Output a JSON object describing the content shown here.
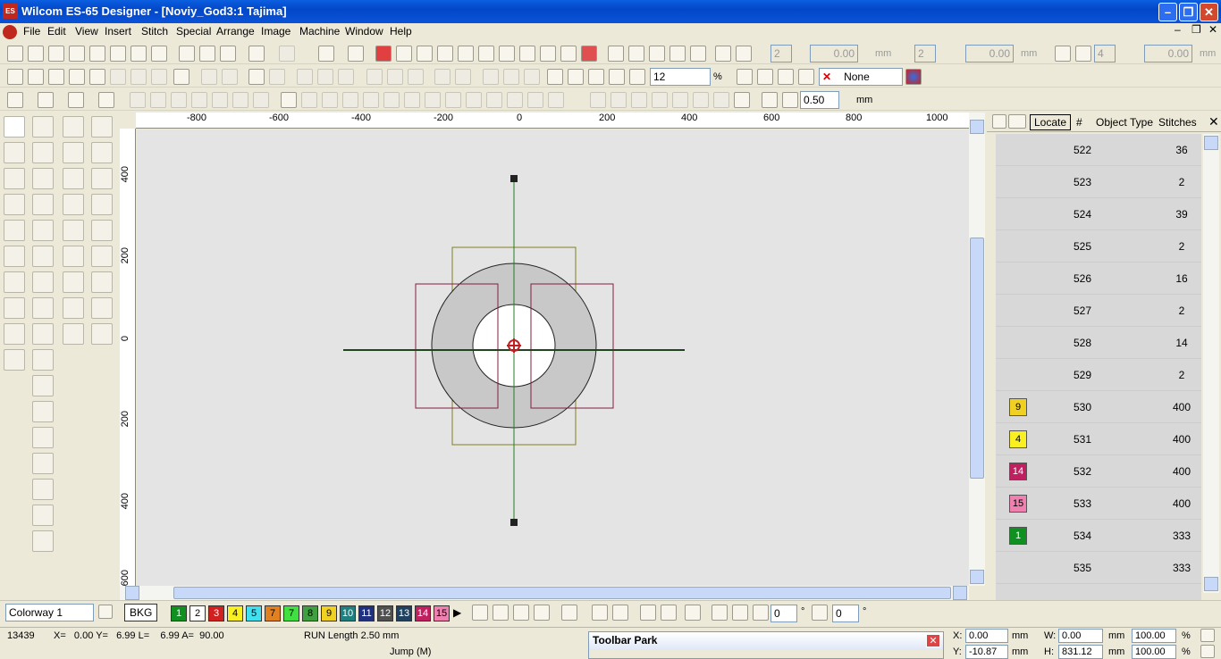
{
  "app": {
    "icon_text": "ES",
    "title": "Wilcom ES-65 Designer - [Noviy_God3:1          Tajima]"
  },
  "menu": [
    "File",
    "Edit",
    "View",
    "Insert",
    "Stitch",
    "Special",
    "Arrange",
    "Image",
    "Machine",
    "Window",
    "Help"
  ],
  "toolbar1": {
    "field1": "2",
    "field2": "0.00",
    "unit1": "mm",
    "field3": "2",
    "field4": "0.00",
    "unit2": "mm",
    "field5": "4",
    "field6": "0.00",
    "unit3": "mm"
  },
  "toolbar2": {
    "zoom_value": "12",
    "zoom_unit": "%",
    "color_select": "None"
  },
  "toolbar3": {
    "size_value": "0.50",
    "size_unit": "mm"
  },
  "ruler": {
    "h_labels": [
      "-800",
      "-600",
      "-400",
      "-200",
      "0",
      "200",
      "400",
      "600",
      "800",
      "1000"
    ],
    "v_labels": [
      "400",
      "200",
      "0",
      "200",
      "400",
      "600"
    ]
  },
  "panel": {
    "header": {
      "locate": "Locate",
      "hash": "#",
      "object": "Object",
      "type": "Type",
      "stitches": "Stitches"
    },
    "rows": [
      {
        "color": "",
        "num": "522",
        "stitches": "36"
      },
      {
        "color": "",
        "num": "523",
        "stitches": "2"
      },
      {
        "color": "",
        "num": "524",
        "stitches": "39"
      },
      {
        "color": "",
        "num": "525",
        "stitches": "2"
      },
      {
        "color": "",
        "num": "526",
        "stitches": "16"
      },
      {
        "color": "",
        "num": "527",
        "stitches": "2"
      },
      {
        "color": "",
        "num": "528",
        "stitches": "14"
      },
      {
        "color": "",
        "num": "529",
        "stitches": "2"
      },
      {
        "color": "9",
        "num": "530",
        "stitches": "400"
      },
      {
        "color": "4",
        "num": "531",
        "stitches": "400"
      },
      {
        "color": "14",
        "num": "532",
        "stitches": "400"
      },
      {
        "color": "15",
        "num": "533",
        "stitches": "400"
      },
      {
        "color": "1",
        "num": "534",
        "stitches": "333"
      },
      {
        "color": "",
        "num": "535",
        "stitches": "333"
      }
    ]
  },
  "colorway": {
    "label": "Colorway 1",
    "bkg": "BKG",
    "colors": [
      "1",
      "2",
      "3",
      "4",
      "5",
      "7",
      "8",
      "9",
      "10",
      "11",
      "13",
      "14",
      "15"
    ],
    "rot1": "0",
    "rot2": "0",
    "deg": "°"
  },
  "status": {
    "count": "13439",
    "coords": "X=   0.00 Y=   6.99 L=    6.99 A=  90.00",
    "run": "RUN Length   2.50 mm",
    "jump": "Jump (M)",
    "x_label": "X:",
    "x_val": "0.00",
    "y_label": "Y:",
    "y_val": "-10.87",
    "w_label": "W:",
    "w_val": "0.00",
    "h_label": "H:",
    "h_val": "831.12",
    "mm": "mm",
    "pct1": "100.00",
    "pct2": "100.00",
    "pct": "%"
  },
  "toolbar_park": {
    "title": "Toolbar Park"
  }
}
